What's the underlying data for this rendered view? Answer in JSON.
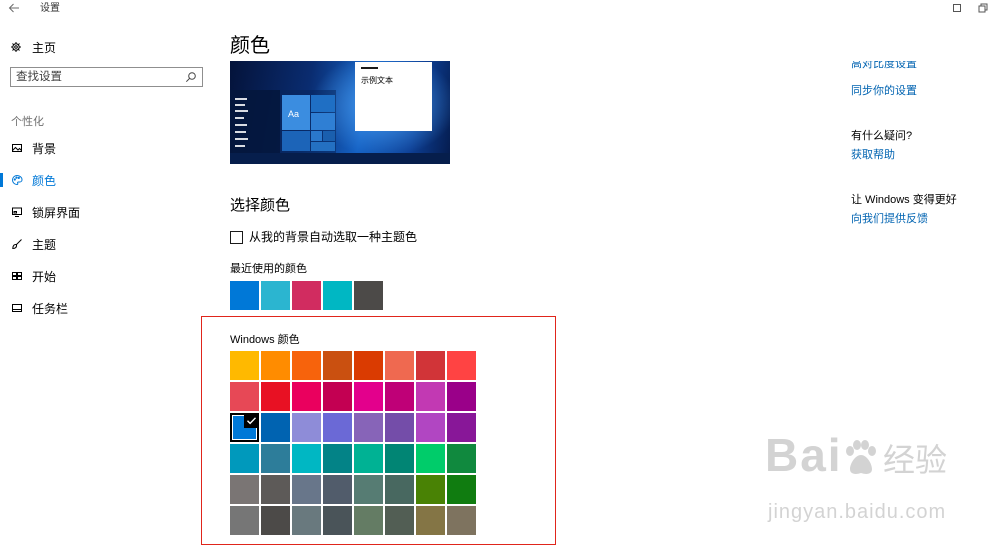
{
  "window": {
    "title": "设置",
    "back_icon": "back-arrow-icon",
    "control_icons": [
      "maximize-icon",
      "restore-icon"
    ]
  },
  "sidebar": {
    "home": {
      "label": "主页",
      "icon": "gear-icon"
    },
    "search": {
      "placeholder": "查找设置",
      "value": "",
      "icon": "search-icon"
    },
    "section_title": "个性化",
    "items": [
      {
        "label": "背景",
        "icon": "picture-icon",
        "selected": false
      },
      {
        "label": "颜色",
        "icon": "palette-icon",
        "selected": true
      },
      {
        "label": "锁屏界面",
        "icon": "lock-screen-icon",
        "selected": false
      },
      {
        "label": "主题",
        "icon": "brush-icon",
        "selected": false
      },
      {
        "label": "开始",
        "icon": "start-tiles-icon",
        "selected": false
      },
      {
        "label": "任务栏",
        "icon": "taskbar-icon",
        "selected": false
      }
    ]
  },
  "main": {
    "title": "颜色",
    "preview": {
      "tile_text": "Aa",
      "sample_text": "示例文本"
    },
    "choose_heading": "选择颜色",
    "auto_pick": {
      "label": "从我的背景自动选取一种主题色",
      "checked": false
    },
    "recent_label": "最近使用的颜色",
    "recent_colors": [
      "#0078D7",
      "#2BB5D0",
      "#D12C60",
      "#00B7C3",
      "#4C4A48"
    ],
    "windows_colors_label": "Windows 颜色",
    "windows_colors": [
      [
        "#FFB900",
        "#FF8C00",
        "#F7630C",
        "#CA5010",
        "#DA3B01",
        "#EF6950",
        "#D13438",
        "#FF4343"
      ],
      [
        "#E74856",
        "#E81123",
        "#EA005E",
        "#C30052",
        "#E3008C",
        "#BF0077",
        "#C239B3",
        "#9A0089"
      ],
      [
        "#0078D7",
        "#0063B1",
        "#8E8CD8",
        "#6B69D6",
        "#8764B8",
        "#744DA9",
        "#B146C2",
        "#881798"
      ],
      [
        "#0099BC",
        "#2D7D9A",
        "#00B7C3",
        "#038387",
        "#00B294",
        "#018574",
        "#00CC6A",
        "#10893E"
      ],
      [
        "#7A7574",
        "#5D5A58",
        "#68768A",
        "#515C6B",
        "#567C73",
        "#486860",
        "#498205",
        "#107C10"
      ],
      [
        "#767676",
        "#4C4A48",
        "#69797E",
        "#4A5459",
        "#647C64",
        "#525E54",
        "#847545",
        "#7E735F"
      ]
    ],
    "selected_color": "#0078D7"
  },
  "related": {
    "high_contrast_link": "高对比度设置",
    "sync_link": "同步你的设置",
    "help_heading": "有什么疑问?",
    "help_link": "获取帮助",
    "feedback_heading": "让 Windows 变得更好",
    "feedback_link": "向我们提供反馈"
  },
  "watermark": {
    "logo_left": "Bai",
    "logo_icon": "paw-icon",
    "logo_right": "经验",
    "url": "jingyan.baidu.com"
  },
  "colors": {
    "accent": "#0078D7",
    "link": "#0063B1",
    "annotation_border": "#E0251B"
  }
}
